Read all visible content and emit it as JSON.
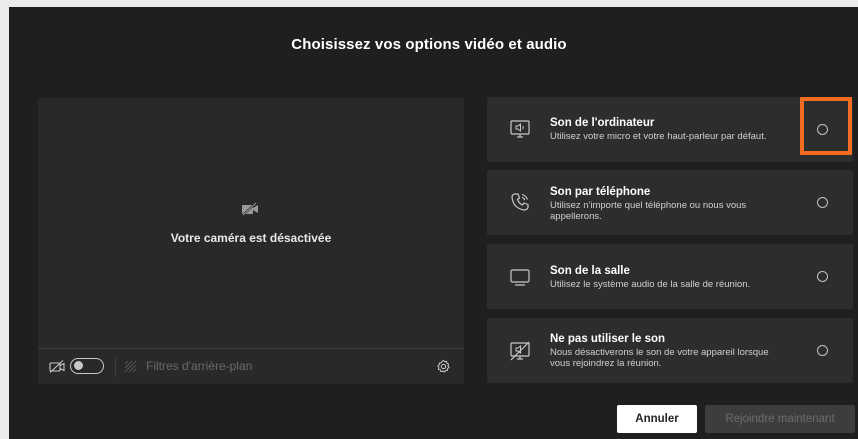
{
  "dialog": {
    "title": "Choisissez vos options vidéo et audio"
  },
  "preview": {
    "camera_off_text": "Votre caméra est désactivée",
    "filters_label": "Filtres d'arrière-plan",
    "camera_toggle_on": false
  },
  "audio_options": [
    {
      "title": "Son de l'ordinateur",
      "description": "Utilisez votre micro et votre haut-parleur par défaut.",
      "icon": "computer-audio-icon",
      "selected": false
    },
    {
      "title": "Son par téléphone",
      "description": "Utilisez n'importe quel téléphone ou nous vous appellerons.",
      "icon": "phone-icon",
      "selected": false
    },
    {
      "title": "Son de la salle",
      "description": "Utilisez le système audio de la salle de réunion.",
      "icon": "room-display-icon",
      "selected": false
    },
    {
      "title": "Ne pas utiliser le son",
      "description": "Nous désactiverons le son de votre appareil lorsque vous rejoindrez la réunion.",
      "icon": "no-audio-icon",
      "selected": false
    }
  ],
  "actions": {
    "cancel_label": "Annuler",
    "join_label": "Rejoindre maintenant"
  },
  "colors": {
    "background": "#1f1f1f",
    "panel": "#2d2d2d",
    "highlight": "#f26d21"
  }
}
